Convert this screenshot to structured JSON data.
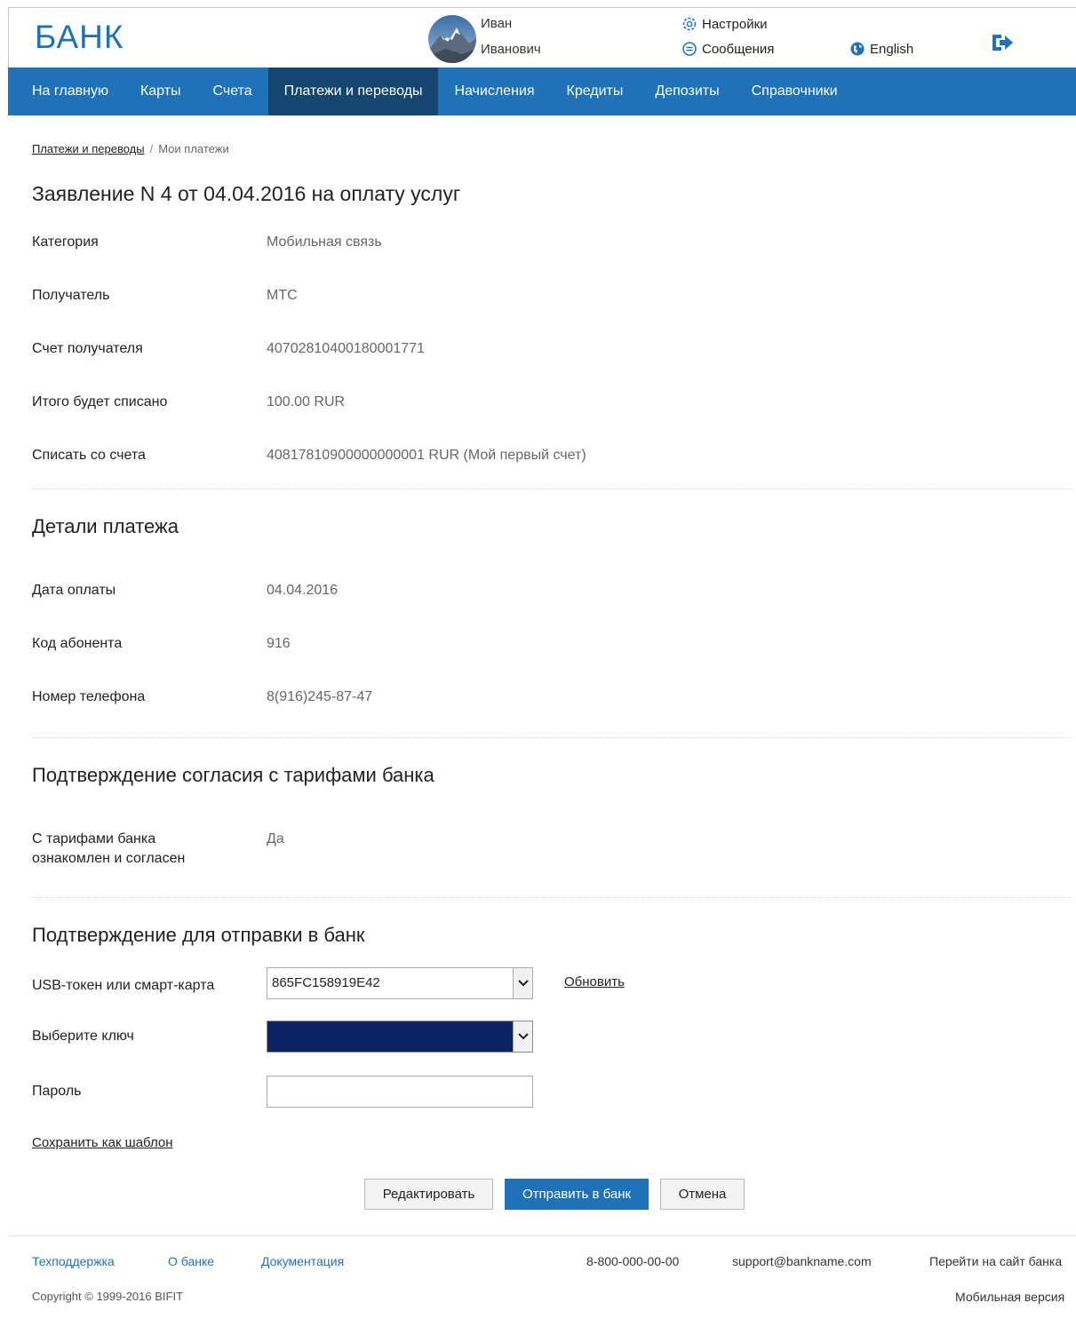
{
  "header": {
    "logo": "БАНК",
    "user_first_name": "Иван",
    "user_last_name": "Иванович",
    "settings_label": "Настройки",
    "messages_label": "Сообщения",
    "language_label": "English"
  },
  "nav": {
    "items": [
      {
        "label": "На главную"
      },
      {
        "label": "Карты"
      },
      {
        "label": "Счета"
      },
      {
        "label": "Платежи и переводы"
      },
      {
        "label": "Начисления"
      },
      {
        "label": "Кредиты"
      },
      {
        "label": "Депозиты"
      },
      {
        "label": "Справочники"
      }
    ],
    "active_index": 3
  },
  "breadcrumb": {
    "link": "Платежи и переводы",
    "separator": "/",
    "current": "Мои платежи"
  },
  "page": {
    "title": "Заявление N 4 от 04.04.2016 на оплату услуг"
  },
  "summary": [
    {
      "label": "Категория",
      "value": "Мобильная связь"
    },
    {
      "label": "Получатель",
      "value": "МТС"
    },
    {
      "label": "Счет получателя",
      "value": "40702810400180001771"
    },
    {
      "label": "Итого будет списано",
      "value": "100.00 RUR"
    },
    {
      "label": "Списать со счета",
      "value": "40817810900000000001 RUR (Мой первый счет)"
    }
  ],
  "details": {
    "title": "Детали платежа",
    "rows": [
      {
        "label": "Дата оплаты",
        "value": "04.04.2016"
      },
      {
        "label": "Код абонента",
        "value": "916"
      },
      {
        "label": "Номер телефона",
        "value": "8(916)245-87-47"
      }
    ]
  },
  "tariffs": {
    "title": "Подтверждение согласия с тарифами банка",
    "label_line1": "С тарифами банка",
    "label_line2": "ознакомлен и согласен",
    "value": "Да"
  },
  "confirm": {
    "title": "Подтверждение для отправки в банк",
    "token_label": "USB-токен или смарт-карта",
    "token_value": "865FC158919E42",
    "refresh_label": "Обновить",
    "key_label": "Выберите ключ",
    "key_value": "",
    "password_label": "Пароль",
    "password_value": "",
    "save_template_label": "Сохранить как шаблон"
  },
  "buttons": {
    "edit": "Редактировать",
    "send": "Отправить в банк",
    "cancel": "Отмена"
  },
  "footer": {
    "support": "Техподдержка",
    "about": "О банке",
    "docs": "Документация",
    "phone": "8-800-000-00-00",
    "email": "support@bankname.com",
    "bank_site": "Перейти на сайт банка",
    "copyright_prefix": "Copyright © 1999-2016",
    "copyright_brand": "BIFIT",
    "mobile": "Мобильная версия"
  },
  "colors": {
    "brand_blue": "#1f72b8",
    "nav_active": "#14466f",
    "key_select_fill": "#0c2463"
  }
}
